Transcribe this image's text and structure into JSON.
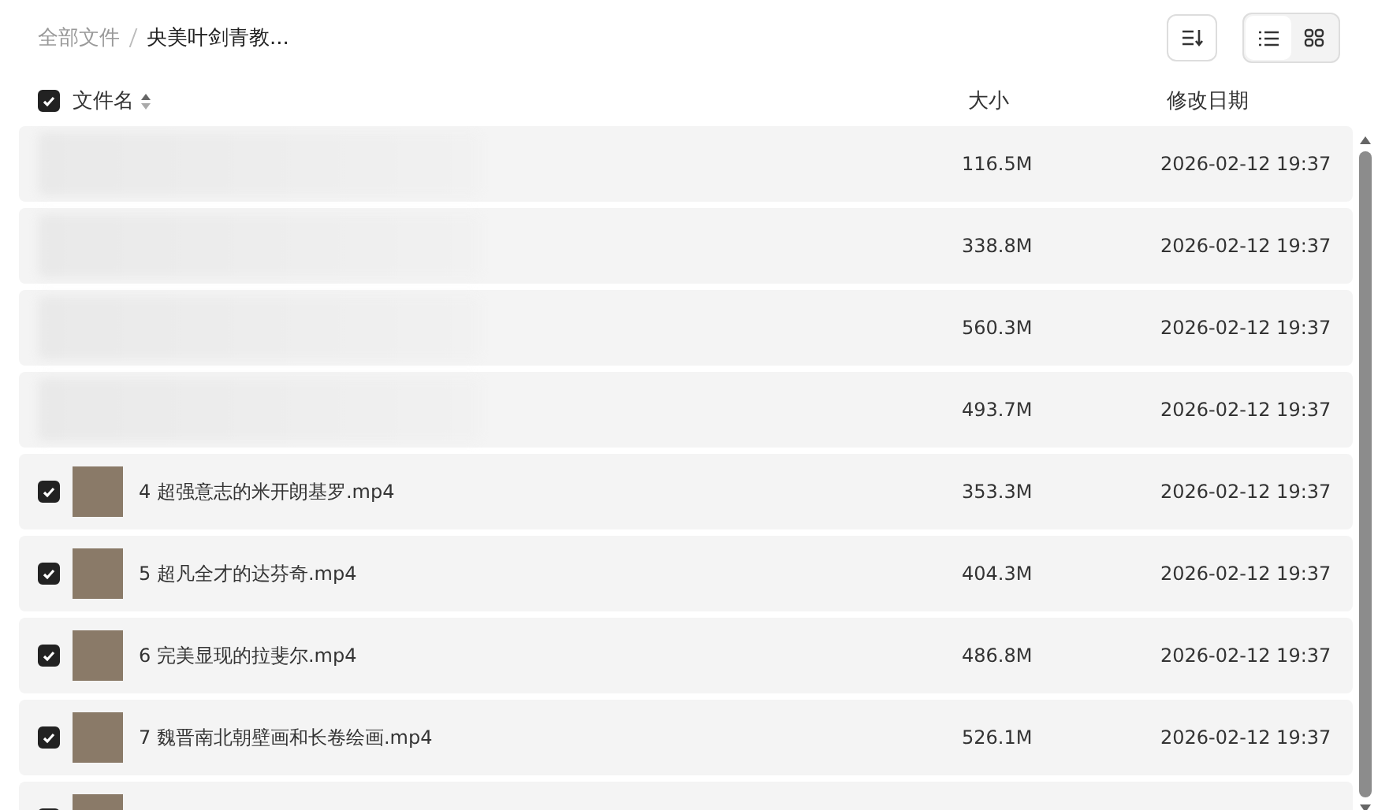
{
  "breadcrumb": [
    {
      "label": "全部文件",
      "current": false
    },
    {
      "label": "央美叶剑青教...",
      "current": true
    }
  ],
  "view_toggle": [
    {
      "kind": "list",
      "selected": true
    },
    {
      "kind": "grid",
      "selected": false
    }
  ],
  "header": {
    "checked": true,
    "name": "文件名",
    "size": "大小",
    "date": "修改日期"
  },
  "rows": [
    {
      "obscured": true,
      "size": "116.5M",
      "date": "2026-02-12 19:37"
    },
    {
      "obscured": true,
      "size": "338.8M",
      "date": "2026-02-12 19:37"
    },
    {
      "obscured": true,
      "size": "560.3M",
      "date": "2026-02-12 19:37"
    },
    {
      "obscured": true,
      "size": "493.7M",
      "date": "2026-02-12 19:37"
    },
    {
      "obscured": false,
      "checked": true,
      "name": "4 超强意志的米开朗基罗.mp4",
      "size": "353.3M",
      "date": "2026-02-12 19:37"
    },
    {
      "obscured": false,
      "checked": true,
      "name": "5 超凡全才的达芬奇.mp4",
      "size": "404.3M",
      "date": "2026-02-12 19:37"
    },
    {
      "obscured": false,
      "checked": true,
      "name": "6 完美显现的拉斐尔.mp4",
      "size": "486.8M",
      "date": "2026-02-12 19:37"
    },
    {
      "obscured": false,
      "checked": true,
      "name": "7 魏晋南北朝壁画和长卷绘画.mp4",
      "size": "526.1M",
      "date": "2026-02-12 19:37"
    },
    {
      "obscured": false,
      "checked": true
    }
  ]
}
